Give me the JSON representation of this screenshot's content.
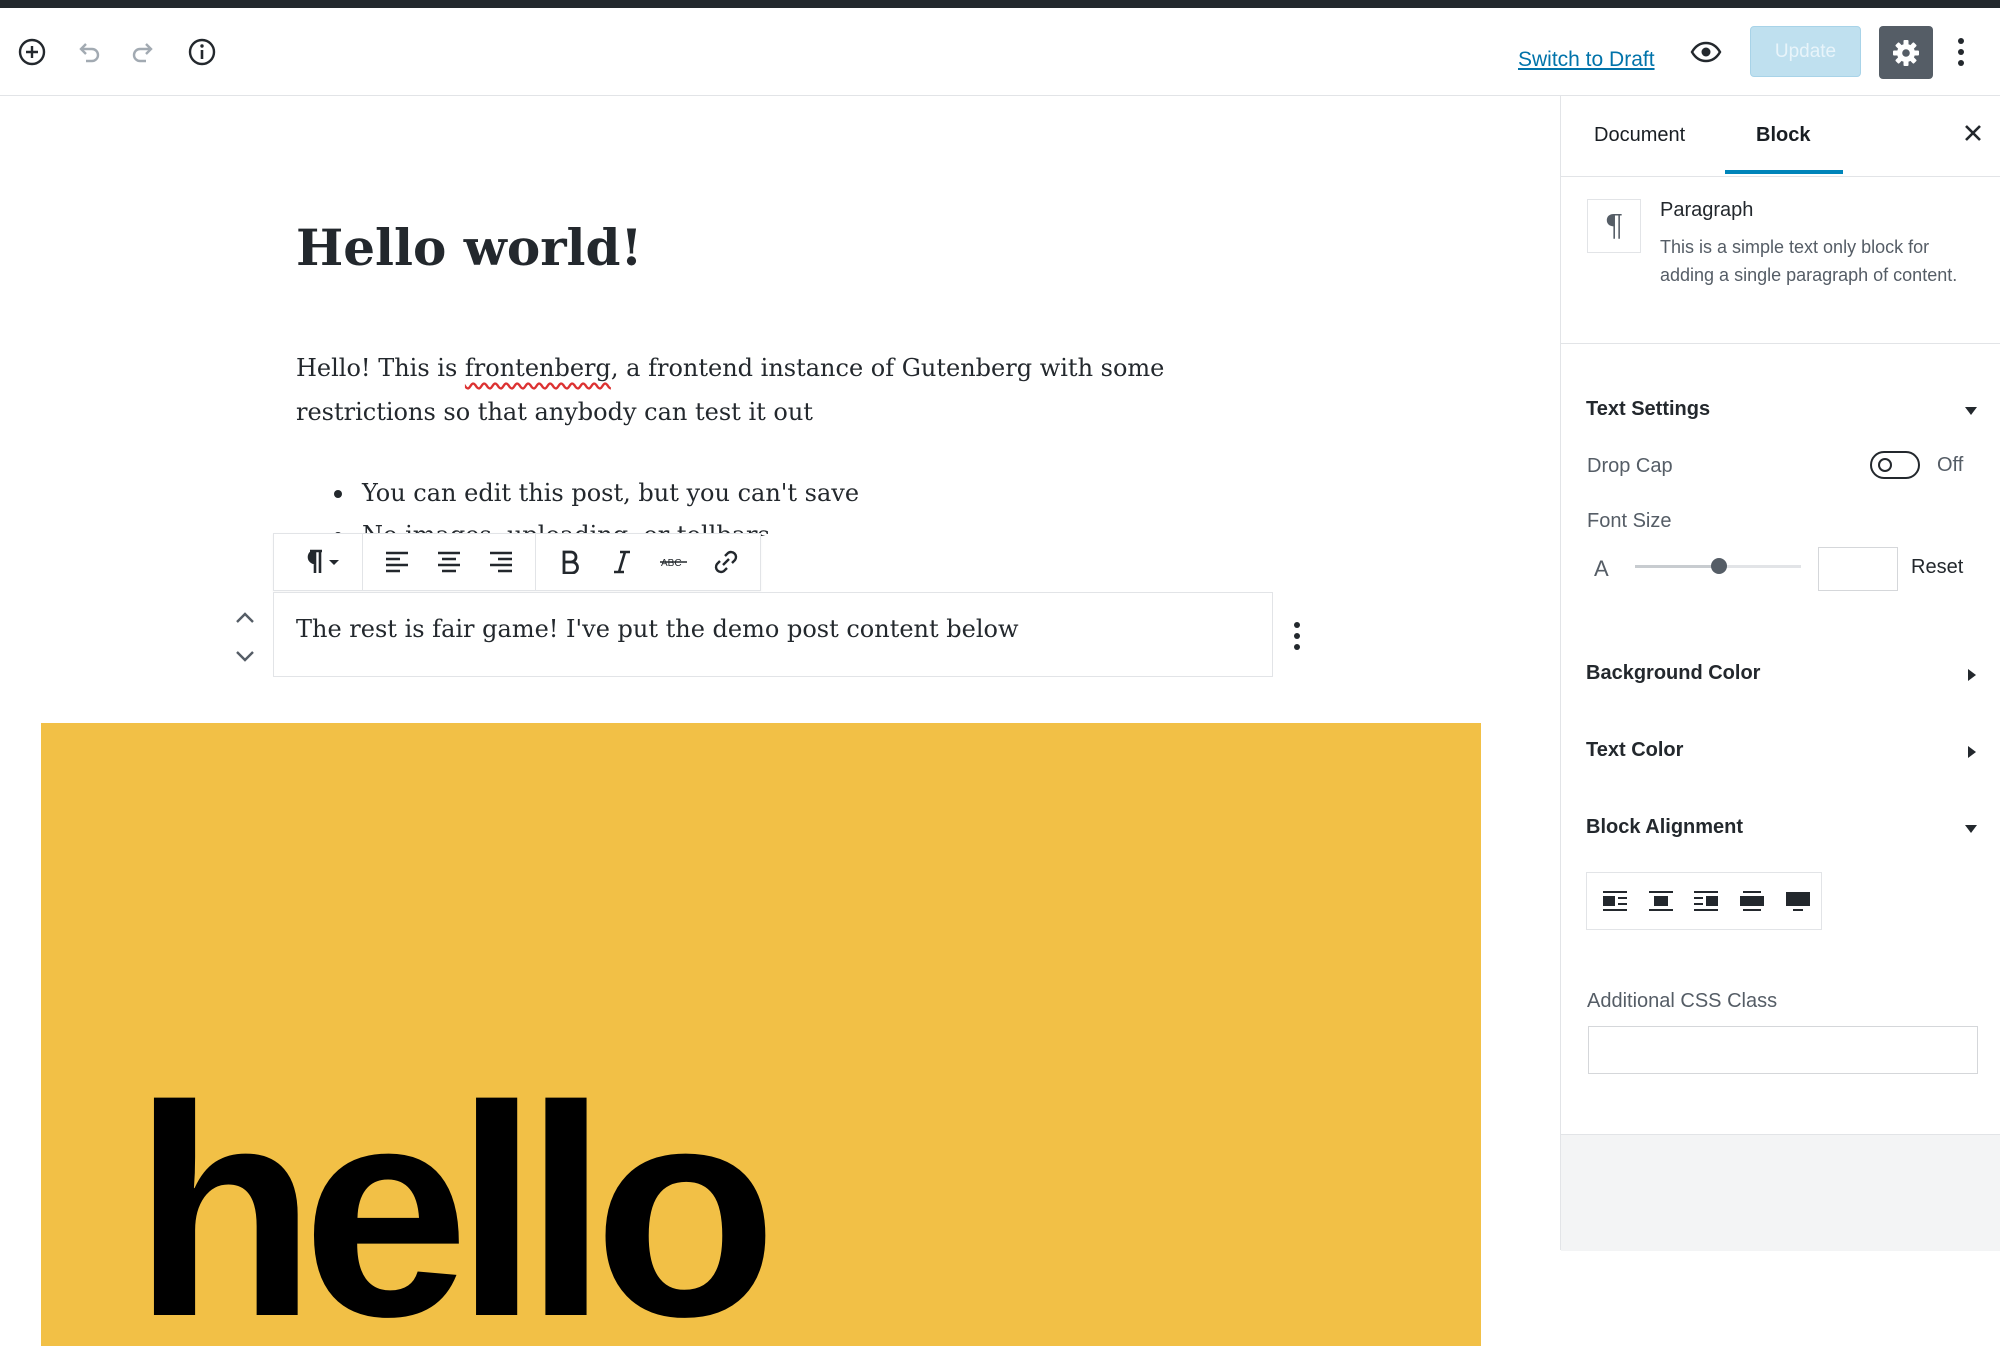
{
  "header": {
    "switch_to_draft": "Switch to Draft",
    "update_label": "Update"
  },
  "editor": {
    "post_title": "Hello world!",
    "paragraph_before": "Hello! This is ",
    "paragraph_link_word": "frontenberg",
    "paragraph_after": ", a frontend instance of Gutenberg with some restrictions so that anybody can test it out",
    "list_items": [
      "You can edit this post, but you can't save",
      "No images, uploading, or tollbars"
    ],
    "active_block_text": "The rest is fair game! I've put the demo post content below",
    "cover_text": "hello"
  },
  "sidebar": {
    "tabs": {
      "document": "Document",
      "block": "Block"
    },
    "block_card": {
      "icon_glyph": "¶",
      "name": "Paragraph",
      "description": "This is a simple text only block for adding a single paragraph of content."
    },
    "text_settings": {
      "title": "Text Settings",
      "drop_cap_label": "Drop Cap",
      "drop_cap_state": "Off",
      "font_size_label": "Font Size",
      "font_size_icon": "A",
      "reset_label": "Reset"
    },
    "background_color_title": "Background Color",
    "text_color_title": "Text Color",
    "block_alignment_title": "Block Alignment",
    "additional_css_label": "Additional CSS Class"
  },
  "icons": [
    "add-block-icon",
    "undo-icon",
    "redo-icon",
    "info-icon",
    "eye-icon",
    "gear-icon",
    "more-vertical-icon",
    "paragraph-icon",
    "align-left-icon",
    "align-center-icon",
    "align-right-icon",
    "bold-icon",
    "italic-icon",
    "strikethrough-icon",
    "link-icon",
    "chevron-up-icon",
    "chevron-down-icon",
    "close-icon"
  ],
  "colors": {
    "accent": "#0085ba",
    "link": "#0073aa",
    "cover": "#f2c046",
    "update_disabled": "#bfe0ef",
    "settings_active": "#555d66"
  }
}
